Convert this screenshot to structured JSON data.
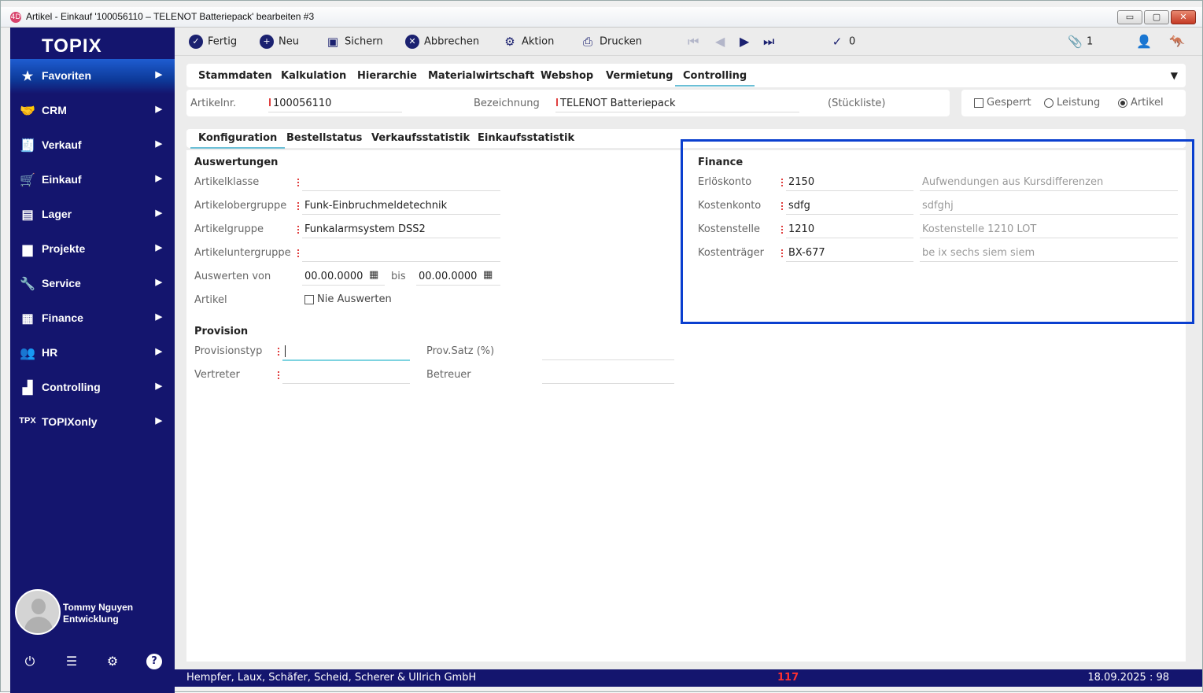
{
  "window": {
    "title": "Artikel - Einkauf '100056110 – TELENOT Batteriepack' bearbeiten #3",
    "app_icon": "4D",
    "buttons": {
      "minimize": "▭",
      "maximize": "▢",
      "close": "✕"
    }
  },
  "sidebar": {
    "logo": "TOPIX",
    "items": [
      {
        "label": "Favoriten",
        "icon": "star-icon",
        "glyph": "★"
      },
      {
        "label": "CRM",
        "icon": "handshake-icon",
        "glyph": "🤝"
      },
      {
        "label": "Verkauf",
        "icon": "cash-register-icon",
        "glyph": "🧾"
      },
      {
        "label": "Einkauf",
        "icon": "cart-icon",
        "glyph": "🛒"
      },
      {
        "label": "Lager",
        "icon": "warehouse-icon",
        "glyph": "▤"
      },
      {
        "label": "Projekte",
        "icon": "folder-icon",
        "glyph": "▆"
      },
      {
        "label": "Service",
        "icon": "wrench-icon",
        "glyph": "🔧"
      },
      {
        "label": "Finance",
        "icon": "calculator-icon",
        "glyph": "▦"
      },
      {
        "label": "HR",
        "icon": "people-icon",
        "glyph": "👥"
      },
      {
        "label": "Controlling",
        "icon": "bar-chart-icon",
        "glyph": "▟"
      },
      {
        "label": "TOPIXonly",
        "icon": "tpx-icon",
        "glyph": "TPX"
      }
    ],
    "arrow": "▶",
    "user": {
      "name": "Tommy Nguyen",
      "role": "Entwicklung"
    },
    "footer_icons": [
      {
        "name": "power-icon",
        "glyph": "⏻"
      },
      {
        "name": "list-icon",
        "glyph": "☰"
      },
      {
        "name": "gear-icon",
        "glyph": "⚙"
      },
      {
        "name": "help-icon",
        "glyph": "?"
      }
    ]
  },
  "toolbar": {
    "fertig": "Fertig",
    "neu": "Neu",
    "sichern": "Sichern",
    "abbrechen": "Abbrechen",
    "aktion": "Aktion",
    "drucken": "Drucken",
    "check_count": "0",
    "attach_count": "1"
  },
  "main_tabs": [
    "Stammdaten",
    "Kalkulation",
    "Hierarchie",
    "Materialwirtschaft",
    "Webshop",
    "Vermietung",
    "Controlling"
  ],
  "header": {
    "artikelnr_label": "Artikelnr.",
    "artikelnr_value": "100056110",
    "bezeichnung_label": "Bezeichnung",
    "bezeichnung_value": "TELENOT Batteriepack",
    "stueckliste": "(Stückliste)",
    "gesperrt": "Gesperrt",
    "leistung": "Leistung",
    "artikel": "Artikel"
  },
  "sub_tabs": [
    "Konfiguration",
    "Bestellstatus",
    "Verkaufsstatistik",
    "Einkaufsstatistik"
  ],
  "auswertungen": {
    "title": "Auswertungen",
    "artikelklasse_label": "Artikelklasse",
    "artikelklasse_value": "",
    "artikelobergruppe_label": "Artikelobergruppe",
    "artikelobergruppe_value": "Funk-Einbruchmeldetechnik",
    "artikelgruppe_label": "Artikelgruppe",
    "artikelgruppe_value": "Funkalarmsystem DSS2",
    "artikeluntergruppe_label": "Artikeluntergruppe",
    "artikeluntergruppe_value": "",
    "auswerten_von_label": "Auswerten von",
    "von_value": "00.00.0000",
    "bis_label": "bis",
    "bis_value": "00.00.0000",
    "artikel_label": "Artikel",
    "nie_auswerten": "Nie Auswerten"
  },
  "finance": {
    "title": "Finance",
    "erloeskonto_label": "Erlöskonto",
    "erloeskonto_value": "2150",
    "erloeskonto_desc": "Aufwendungen aus Kursdifferenzen",
    "kostenkonto_label": "Kostenkonto",
    "kostenkonto_value": "sdfg",
    "kostenkonto_desc": "sdfghj",
    "kostenstelle_label": "Kostenstelle",
    "kostenstelle_value": "1210",
    "kostenstelle_desc": "Kostenstelle 1210 LOT",
    "kostentraeger_label": "Kostenträger",
    "kostentraeger_value": "BX-677",
    "kostentraeger_desc": "be ix sechs siem siem"
  },
  "provision": {
    "title": "Provision",
    "provisionstyp_label": "Provisionstyp",
    "provisionstyp_value": "",
    "prov_satz_label": "Prov.Satz (%)",
    "vertreter_label": "Vertreter",
    "betreuer_label": "Betreuer"
  },
  "status": {
    "company": "Hempfer, Laux, Schäfer, Scheid, Scherer & Ullrich GmbH",
    "count": "117",
    "date": "18.09.2025 : 98"
  },
  "colors": {
    "sidebar": "#14156e",
    "highlight": "#0a3fcf",
    "accent": "#6bbfd6"
  }
}
